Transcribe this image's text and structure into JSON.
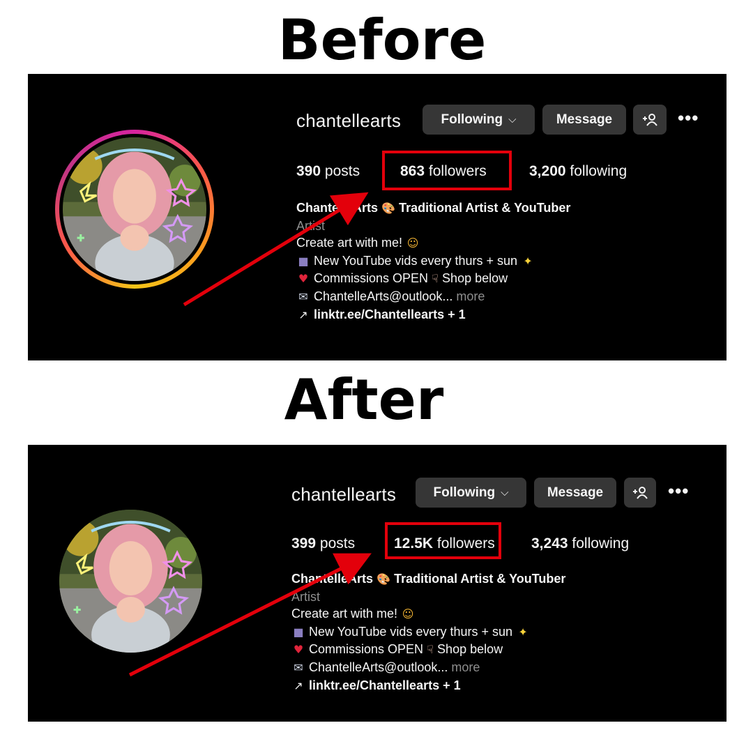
{
  "before": {
    "heading": "Before",
    "profile": {
      "username": "chantellearts",
      "following_button": "Following",
      "message_button": "Message",
      "stats": {
        "posts_count": "390",
        "posts_label": "posts",
        "followers_count": "863",
        "followers_label": "followers",
        "following_count": "3,200",
        "following_label": "following"
      },
      "bio": {
        "name": "ChantelleArts",
        "title": "Traditional Artist & YouTuber",
        "category": "Artist",
        "line1": "Create art with me!",
        "line2": "New YouTube vids every thurs + sun",
        "line3": "Commissions OPEN",
        "line3b": "Shop below",
        "line4": "ChantelleArts@outlook...",
        "more": "more",
        "link": "linktr.ee/Chantellearts + 1"
      }
    }
  },
  "after": {
    "heading": "After",
    "profile": {
      "username": "chantellearts",
      "following_button": "Following",
      "message_button": "Message",
      "stats": {
        "posts_count": "399",
        "posts_label": "posts",
        "followers_count": "12.5K",
        "followers_label": "followers",
        "following_count": "3,243",
        "following_label": "following"
      },
      "bio": {
        "name": "ChantelleArts",
        "title": "Traditional Artist & YouTuber",
        "category": "Artist",
        "line1": "Create art with me!",
        "line2": "New YouTube vids every thurs + sun",
        "line3": "Commissions OPEN",
        "line3b": "Shop below",
        "line4": "ChantelleArts@outlook...",
        "more": "more",
        "link": "linktr.ee/Chantellearts + 1"
      }
    }
  },
  "icons": {
    "chevron": "chevron-down-icon",
    "add_person": "add-person-icon",
    "more": "more-options-icon",
    "palette": "palette-icon",
    "smiling_face": "smiling-face-with-hearts-icon",
    "camera": "movie-camera-icon",
    "sparkles": "sparkles-icon",
    "heart": "heart-icon",
    "pointing_down": "pointing-down-icon",
    "envelope": "envelope-icon",
    "link": "link-icon"
  },
  "colors": {
    "highlight": "#e3000b",
    "panel_bg": "#000000",
    "button_bg": "#363636",
    "muted_text": "#8e8e8e"
  }
}
